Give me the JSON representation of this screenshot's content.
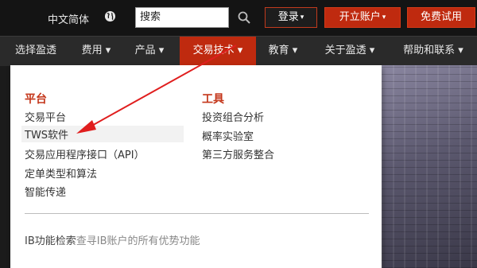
{
  "topbar": {
    "language": "中文简体",
    "globe_icon": "globe-icon",
    "search_value": "搜索",
    "search_icon": "search-icon",
    "login_label": "登录",
    "open_account_label": "开立账户",
    "free_trial_label": "免费试用",
    "caret": "▾"
  },
  "nav": {
    "items": [
      {
        "label": "选择盈透"
      },
      {
        "label": "费用 ▾"
      },
      {
        "label": "产品 ▾"
      },
      {
        "label": "交易技术 ▾"
      },
      {
        "label": "教育 ▾"
      },
      {
        "label": "关于盈透 ▾"
      },
      {
        "label": "帮助和联系 ▾"
      }
    ]
  },
  "dropdown": {
    "platform": {
      "heading": "平台",
      "links": [
        "交易平台",
        "TWS软件",
        "交易应用程序接口（API）",
        "定单类型和算法",
        "智能传递"
      ]
    },
    "tools": {
      "heading": "工具",
      "links": [
        "投资组合分析",
        "概率实验室",
        "第三方服务整合"
      ]
    },
    "footer": {
      "label": "IB功能检索",
      "description": "查寻IB账户的所有优势功能"
    }
  },
  "colors": {
    "accent": "#bf2a0f",
    "heading": "#c4361a",
    "arrow": "#e01e1e"
  }
}
